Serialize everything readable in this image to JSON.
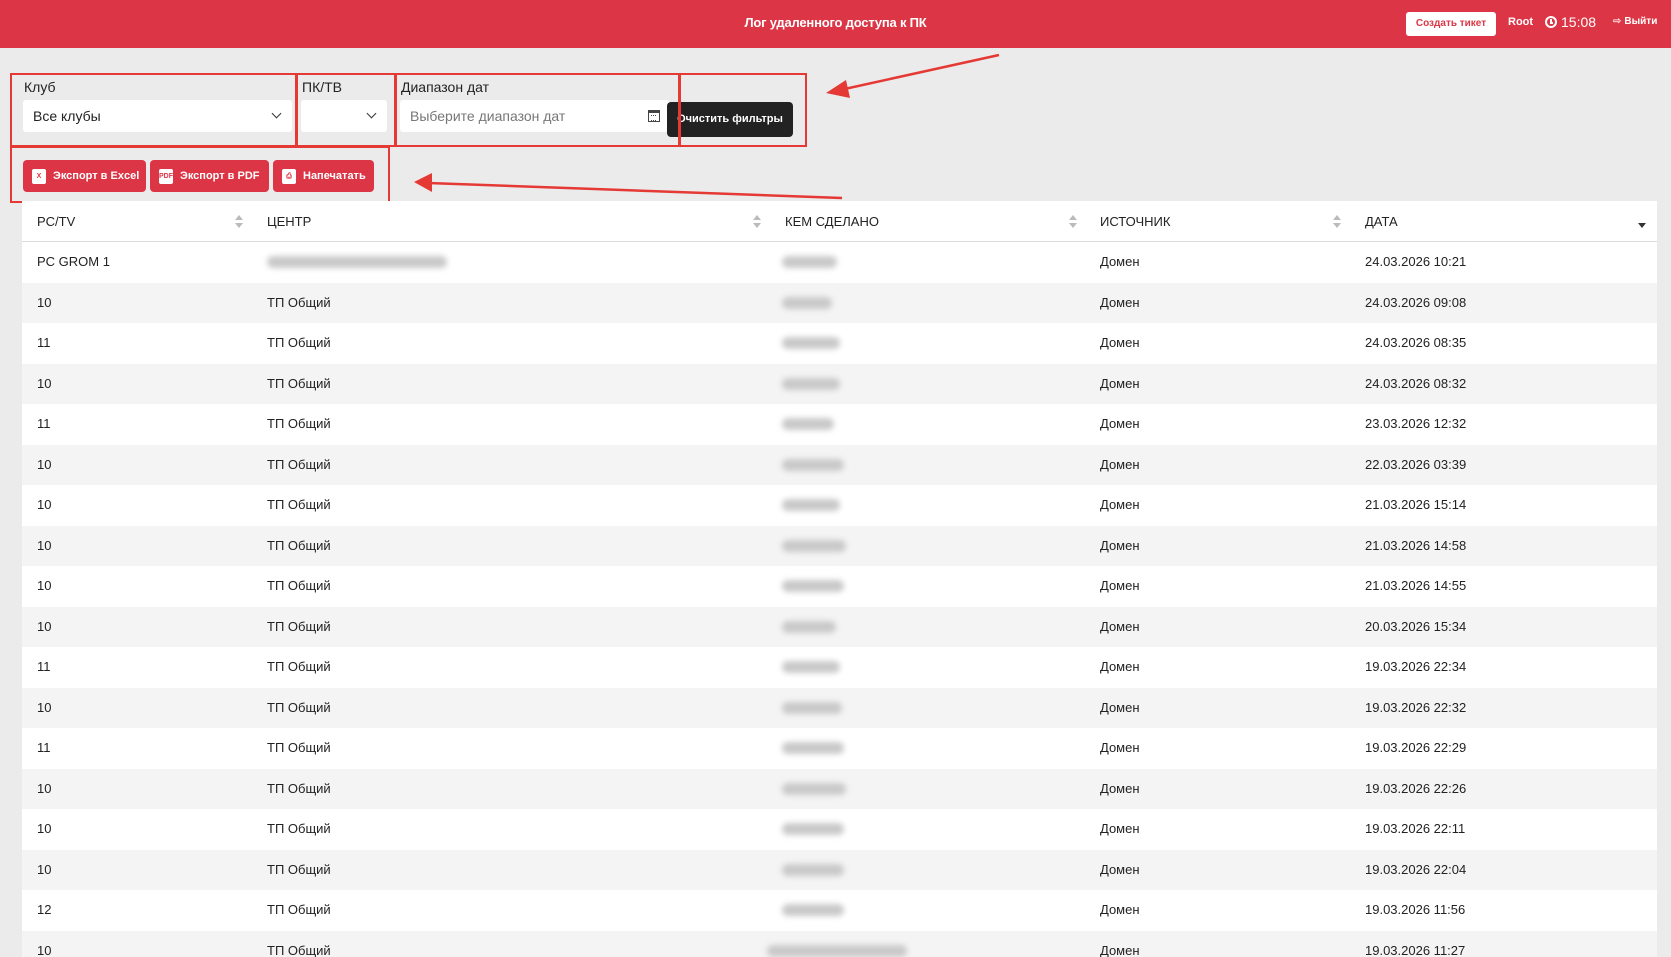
{
  "header": {
    "title": "Лог удаленного доступа к ПК",
    "create_ticket": "Создать тикет",
    "user": "Root",
    "time": "15:08",
    "logout": "Выйти"
  },
  "filters": {
    "club_label": "Клуб",
    "club_value": "Все клубы",
    "pc_label": "ПК/ТВ",
    "pc_value": "",
    "date_label": "Диапазон дат",
    "date_placeholder": "Выберите диапазон дат",
    "clear_button": "Очистить фильтры"
  },
  "actions": {
    "excel": "Экспорт в Excel",
    "pdf": "Экспорт в PDF",
    "print": "Напечатать"
  },
  "table": {
    "columns": [
      "PC/TV",
      "ЦЕНТР",
      "КЕМ СДЕЛАНО",
      "ИСТОЧНИК",
      "ДАТА"
    ],
    "rows": [
      {
        "pc": "PC GROM 1",
        "center": "",
        "by": "",
        "source": "Домен",
        "date": "24.03.2026 10:21"
      },
      {
        "pc": "10",
        "center": "ТП Общий",
        "by": "",
        "source": "Домен",
        "date": "24.03.2026 09:08"
      },
      {
        "pc": "11",
        "center": "ТП Общий",
        "by": "",
        "source": "Домен",
        "date": "24.03.2026 08:35"
      },
      {
        "pc": "10",
        "center": "ТП Общий",
        "by": "",
        "source": "Домен",
        "date": "24.03.2026 08:32"
      },
      {
        "pc": "11",
        "center": "ТП Общий",
        "by": "",
        "source": "Домен",
        "date": "23.03.2026 12:32"
      },
      {
        "pc": "10",
        "center": "ТП Общий",
        "by": "",
        "source": "Домен",
        "date": "22.03.2026 03:39"
      },
      {
        "pc": "10",
        "center": "ТП Общий",
        "by": "",
        "source": "Домен",
        "date": "21.03.2026 15:14"
      },
      {
        "pc": "10",
        "center": "ТП Общий",
        "by": "",
        "source": "Домен",
        "date": "21.03.2026 14:58"
      },
      {
        "pc": "10",
        "center": "ТП Общий",
        "by": "",
        "source": "Домен",
        "date": "21.03.2026 14:55"
      },
      {
        "pc": "10",
        "center": "ТП Общий",
        "by": "",
        "source": "Домен",
        "date": "20.03.2026 15:34"
      },
      {
        "pc": "11",
        "center": "ТП Общий",
        "by": "",
        "source": "Домен",
        "date": "19.03.2026 22:34"
      },
      {
        "pc": "10",
        "center": "ТП Общий",
        "by": "",
        "source": "Домен",
        "date": "19.03.2026 22:32"
      },
      {
        "pc": "11",
        "center": "ТП Общий",
        "by": "",
        "source": "Домен",
        "date": "19.03.2026 22:29"
      },
      {
        "pc": "10",
        "center": "ТП Общий",
        "by": "",
        "source": "Домен",
        "date": "19.03.2026 22:26"
      },
      {
        "pc": "10",
        "center": "ТП Общий",
        "by": "",
        "source": "Домен",
        "date": "19.03.2026 22:11"
      },
      {
        "pc": "10",
        "center": "ТП Общий",
        "by": "",
        "source": "Домен",
        "date": "19.03.2026 22:04"
      },
      {
        "pc": "12",
        "center": "ТП Общий",
        "by": "",
        "source": "Домен",
        "date": "19.03.2026 11:56"
      },
      {
        "pc": "10",
        "center": "ТП Общий",
        "by": "",
        "source": "Домен",
        "date": "19.03.2026 11:27"
      }
    ]
  },
  "colors": {
    "brand": "#dc3545",
    "annotation": "#e53935",
    "dark_button": "#222222",
    "background": "#ebebeb"
  }
}
